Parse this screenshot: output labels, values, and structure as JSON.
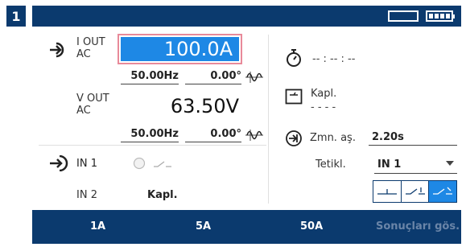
{
  "header": {
    "badge": "1"
  },
  "left": {
    "iout": {
      "label_line1": "I OUT",
      "label_line2": "AC",
      "value": "100.0A",
      "freq": "50.00Hz",
      "phase": "0.00°"
    },
    "vout": {
      "label_line1": "V OUT",
      "label_line2": "AC",
      "value": "63.50V",
      "freq": "50.00Hz",
      "phase": "0.00°"
    },
    "in1": {
      "label": "IN 1"
    },
    "in2": {
      "label": "IN 2",
      "value": "Kapl."
    }
  },
  "right": {
    "timer": {
      "value": "-- : -- : --"
    },
    "kapl": {
      "label": "Kapl.",
      "value": "- - - -"
    },
    "zmn": {
      "label": "Zmn. aş.",
      "value": "2.20s"
    },
    "tetikl": {
      "label": "Tetikl.",
      "value": "IN 1"
    }
  },
  "bottom": {
    "tabs": [
      "1A",
      "5A",
      "50A",
      "Sonuçları gös."
    ]
  },
  "colors": {
    "navy": "#0b3a6e",
    "accent": "#1e88e5",
    "highlight_border": "#e88a9a"
  }
}
